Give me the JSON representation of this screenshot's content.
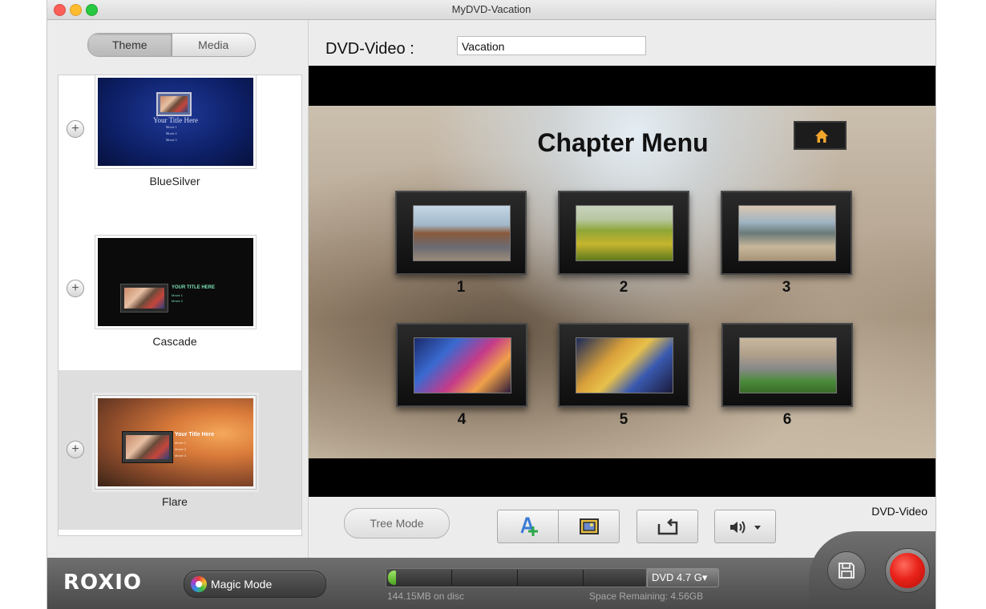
{
  "window": {
    "title": "MyDVD-Vacation"
  },
  "sidebar": {
    "tabs": [
      {
        "label": "Theme"
      },
      {
        "label": "Media"
      }
    ],
    "themes": [
      {
        "name": "BlueSilver",
        "thumb_title": "Your Title Here",
        "thumb_items": [
          "Movie 1",
          "Movie 2",
          "Movie 3"
        ]
      },
      {
        "name": "Cascade",
        "thumb_title": "YOUR TITLE HERE",
        "thumb_items": [
          "Movie 1",
          "Movie 2"
        ]
      },
      {
        "name": "Flare",
        "thumb_title": "Your Title Here",
        "thumb_items": [
          "Movie 1",
          "Movie 2",
          "Movie 3"
        ]
      }
    ],
    "add_symbol": "+"
  },
  "project": {
    "label": "DVD-Video :",
    "name": "Vacation",
    "format": "DVD-Video"
  },
  "preview": {
    "menu_title": "Chapter Menu",
    "chapters": [
      {
        "num": "1"
      },
      {
        "num": "2"
      },
      {
        "num": "3"
      },
      {
        "num": "4"
      },
      {
        "num": "5"
      },
      {
        "num": "6"
      }
    ]
  },
  "toolbar": {
    "tree_mode_label": "Tree Mode",
    "icons": [
      "add-media-icon",
      "add-chapter-image-icon",
      "loop-icon",
      "volume-icon"
    ]
  },
  "footer": {
    "brand": "ROXIO",
    "magic_mode_label": "Magic Mode",
    "disc_type": "DVD 4.7 G▾",
    "used": "144.15MB on disc",
    "remaining": "Space Remaining: 4.56GB",
    "capacity_used_fraction": 0.03
  },
  "colors": {
    "accent_red": "#e8231a",
    "capacity_green": "#4aa41d"
  }
}
